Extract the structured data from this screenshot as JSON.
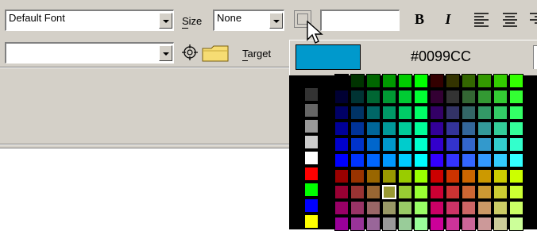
{
  "toolbar": {
    "font_combo": {
      "value": "Default Font"
    },
    "size_label": "Size",
    "size_combo": {
      "value": "None"
    },
    "bold_label": "B",
    "italic_label": "I",
    "link_combo": {
      "value": ""
    },
    "target_label": "Target",
    "text_color_field": {
      "value": ""
    }
  },
  "color_picker": {
    "selected_color": "#0099CC",
    "hex_display": "#0099CC"
  },
  "icons": [
    "dropdown-arrow-icon",
    "point-to-file-icon",
    "folder-icon",
    "align-left-icon",
    "align-center-icon",
    "align-right-icon",
    "mouse-cursor-icon"
  ]
}
